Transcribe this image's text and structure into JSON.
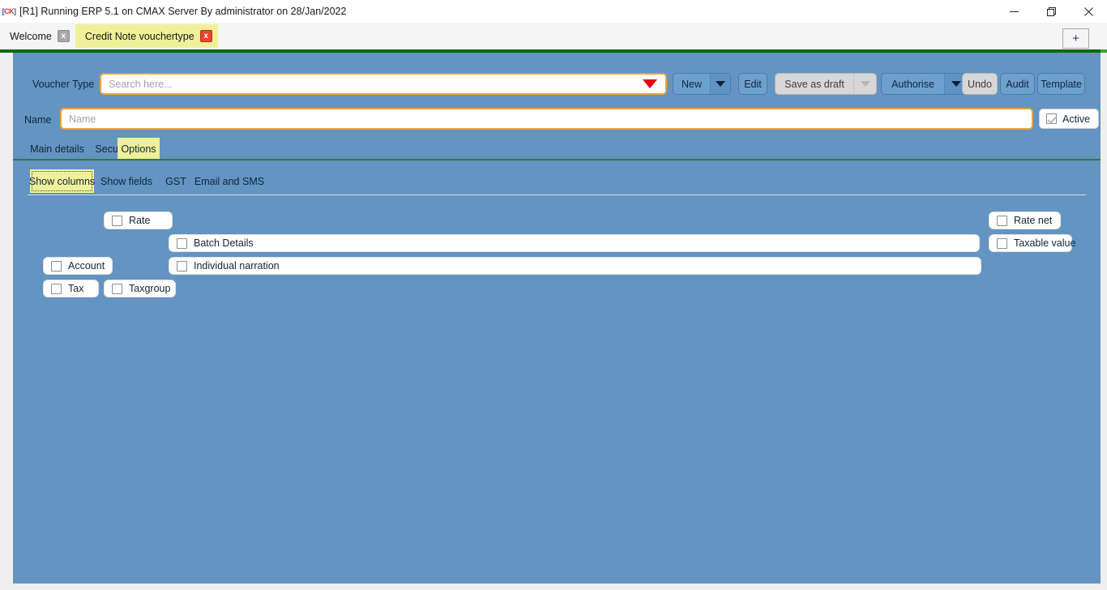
{
  "window": {
    "app_icon_label": "CK",
    "title": "[R1] Running ERP 5.1 on CMAX Server By administrator on 28/Jan/2022",
    "minimize_label": "Minimize",
    "restore_label": "Restore",
    "close_label": "Close"
  },
  "tabs": {
    "items": [
      {
        "label": "Welcome",
        "close_label": "x",
        "active": false
      },
      {
        "label": "Credit Note vouchertype",
        "close_label": "x",
        "active": true
      }
    ],
    "new_tab_label": "+"
  },
  "toolbar": {
    "voucher_type_label": "Voucher Type",
    "search_placeholder": "Search here...",
    "new_label": "New",
    "edit_label": "Edit",
    "save_as_draft_label": "Save as draft",
    "authorise_label": "Authorise",
    "undo_label": "Undo",
    "audit_label": "Audit",
    "template_label": "Template"
  },
  "name_row": {
    "name_label": "Name",
    "name_placeholder": "Name",
    "active_label": "Active"
  },
  "primary_tabs": {
    "items": [
      {
        "label": "Main details",
        "selected": false
      },
      {
        "label": "Security",
        "selected": false
      },
      {
        "label": "Options",
        "selected": true
      }
    ]
  },
  "secondary_tabs": {
    "items": [
      {
        "label": "Show columns",
        "selected": true
      },
      {
        "label": "Show fields",
        "selected": false
      },
      {
        "label": "GST",
        "selected": false
      },
      {
        "label": "Email and SMS",
        "selected": false
      }
    ]
  },
  "show_columns": {
    "options": [
      {
        "label": "Rate",
        "checked": false
      },
      {
        "label": "Batch Details",
        "checked": false
      },
      {
        "label": "Account",
        "checked": false
      },
      {
        "label": "Individual narration",
        "checked": false
      },
      {
        "label": "Tax",
        "checked": false
      },
      {
        "label": "Taxgroup",
        "checked": false
      },
      {
        "label": "Rate net",
        "checked": false
      },
      {
        "label": "Taxable value",
        "checked": false
      }
    ]
  },
  "colors": {
    "canvas_blue": "#6394c2",
    "accent_yellow": "#f0f09a",
    "accent_green": "#0a6b0a",
    "field_focus_orange": "#e7a33a",
    "dropdown_red": "#e00000"
  }
}
